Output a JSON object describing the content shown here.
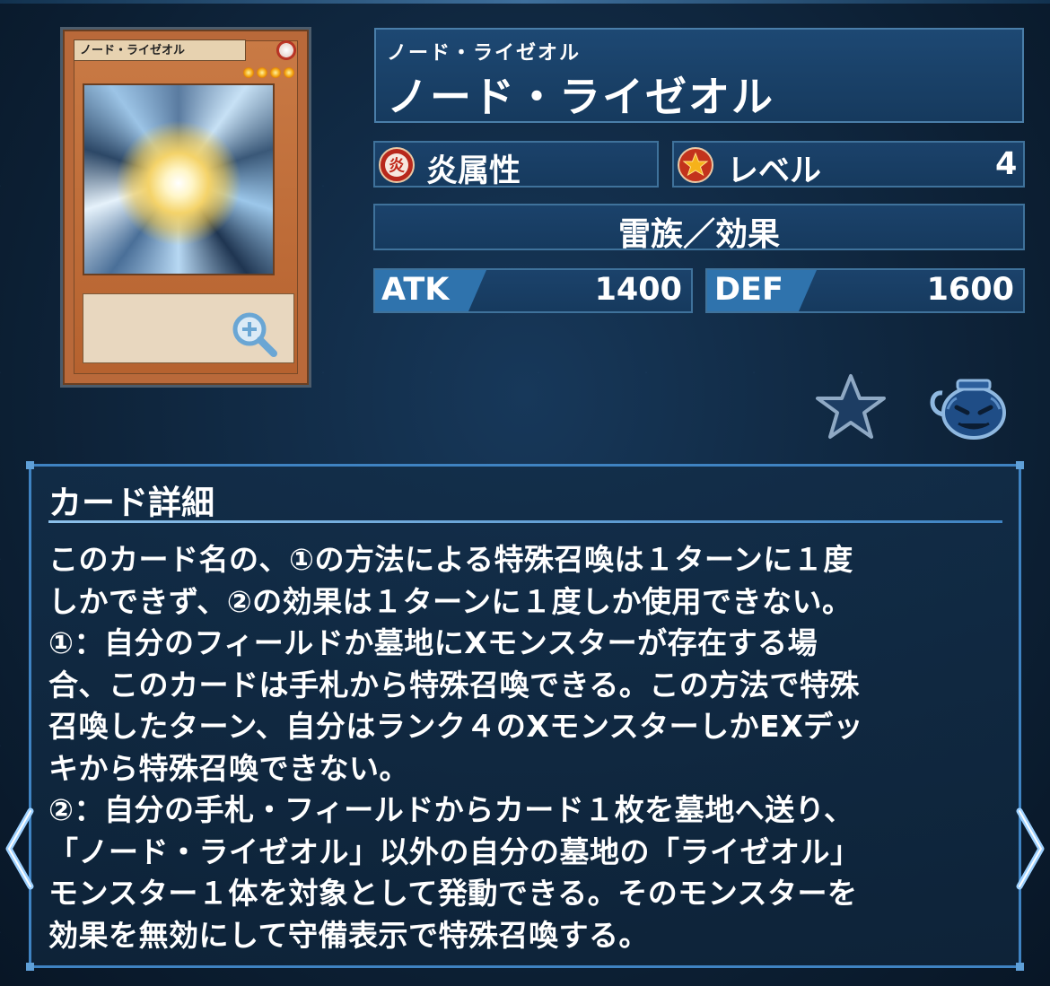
{
  "card": {
    "name_on_card": "ノード・ライゼオル",
    "level_stars": 4
  },
  "header": {
    "name_kana": "ノード・ライゼオル",
    "name": "ノード・ライゼオル"
  },
  "attribute": {
    "label": "炎属性",
    "icon": "fire-attribute-icon"
  },
  "level": {
    "label": "レベル",
    "value": "4",
    "icon": "level-star-icon"
  },
  "type_line": "雷族／効果",
  "stats": {
    "atk_label": "ATK",
    "atk_value": "1400",
    "def_label": "DEF",
    "def_value": "1600"
  },
  "actions": {
    "favorite_icon": "star-icon",
    "pot_icon": "pot-of-greed-icon"
  },
  "details": {
    "title": "カード詳細",
    "lines": [
      "このカード名の、①の方法による特殊召喚は１ターンに１度",
      "しかできず、②の効果は１ターンに１度しか使用できない。",
      "①：自分のフィールドか墓地にXモンスターが存在する場",
      "合、このカードは手札から特殊召喚できる。この方法で特殊",
      "召喚したターン、自分はランク４のXモンスターしかEXデッ",
      "キから特殊召喚できない。",
      "②：自分の手札・フィールドからカード１枚を墓地へ送り、",
      "「ノード・ライゼオル」以外の自分の墓地の「ライゼオル」",
      "モンスター１体を対象として発動できる。そのモンスターを",
      "効果を無効にして守備表示で特殊召喚する。"
    ]
  },
  "colors": {
    "accent": "#3f83c2",
    "panel": "#163a5e",
    "stat_tab": "#2f73ad"
  }
}
